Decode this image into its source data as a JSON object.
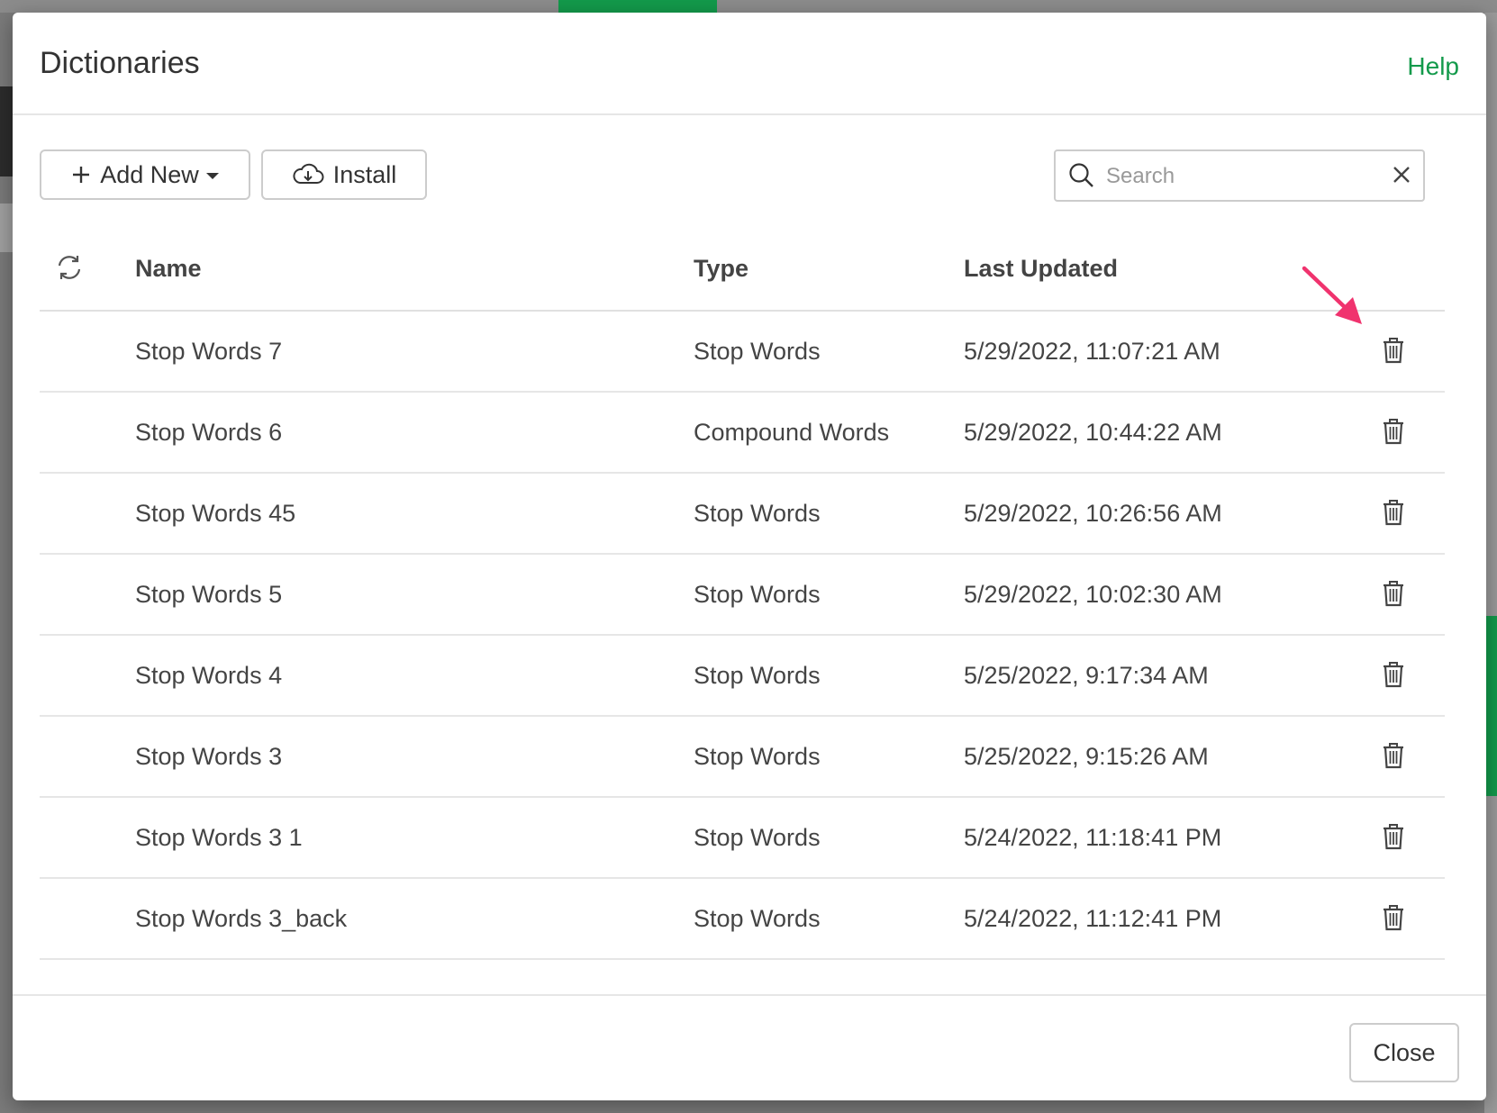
{
  "dialog": {
    "title": "Dictionaries",
    "help_label": "Help"
  },
  "toolbar": {
    "add_new_label": "Add New",
    "install_label": "Install"
  },
  "search": {
    "placeholder": "Search",
    "value": ""
  },
  "table": {
    "columns": {
      "name": "Name",
      "type": "Type",
      "last_updated": "Last Updated"
    },
    "rows": [
      {
        "name": "Stop Words 7",
        "type": "Stop Words",
        "last_updated": "5/29/2022, 11:07:21 AM"
      },
      {
        "name": "Stop Words 6",
        "type": "Compound Words",
        "last_updated": "5/29/2022, 10:44:22 AM"
      },
      {
        "name": "Stop Words 45",
        "type": "Stop Words",
        "last_updated": "5/29/2022, 10:26:56 AM"
      },
      {
        "name": "Stop Words 5",
        "type": "Stop Words",
        "last_updated": "5/29/2022, 10:02:30 AM"
      },
      {
        "name": "Stop Words 4",
        "type": "Stop Words",
        "last_updated": "5/25/2022, 9:17:34 AM"
      },
      {
        "name": "Stop Words 3",
        "type": "Stop Words",
        "last_updated": "5/25/2022, 9:15:26 AM"
      },
      {
        "name": "Stop Words 3 1",
        "type": "Stop Words",
        "last_updated": "5/24/2022, 11:18:41 PM"
      },
      {
        "name": "Stop Words 3_back",
        "type": "Stop Words",
        "last_updated": "5/24/2022, 11:12:41 PM"
      }
    ]
  },
  "footer": {
    "close_label": "Close"
  },
  "icons": {
    "add": "plus-icon",
    "dropdown": "caret-down-icon",
    "install": "cloud-download-icon",
    "search": "search-icon",
    "clear": "close-icon",
    "refresh": "refresh-icon",
    "delete": "trash-icon",
    "annotation": "arrow-icon"
  },
  "colors": {
    "accent": "#139a4b",
    "annotation": "#f0336e",
    "text": "#444444",
    "border": "#cccccc"
  }
}
